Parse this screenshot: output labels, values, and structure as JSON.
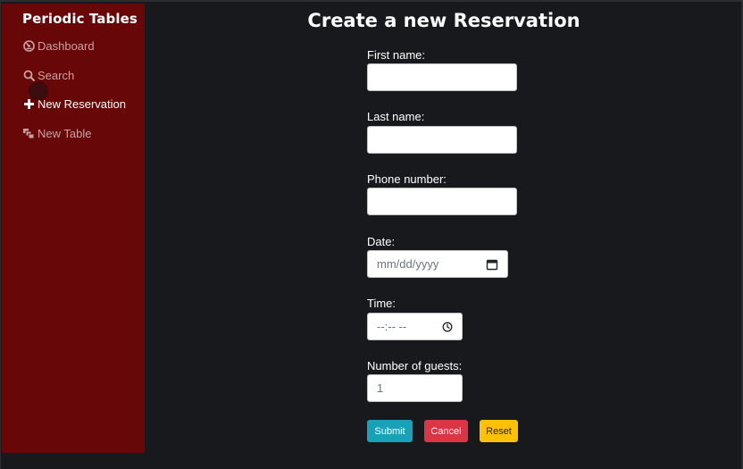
{
  "sidebar": {
    "brand": "Periodic Tables",
    "items": [
      {
        "label": "Dashboard",
        "icon": "dashboard-icon"
      },
      {
        "label": "Search",
        "icon": "search-icon"
      },
      {
        "label": "New Reservation",
        "icon": "plus-icon"
      },
      {
        "label": "New Table",
        "icon": "layers-icon"
      }
    ]
  },
  "main": {
    "title": "Create a new Reservation",
    "form": {
      "first_name": {
        "label": "First name:",
        "value": ""
      },
      "last_name": {
        "label": "Last name:",
        "value": ""
      },
      "phone": {
        "label": "Phone number:",
        "value": ""
      },
      "date": {
        "label": "Date:",
        "placeholder": "mm/dd/yyyy"
      },
      "time": {
        "label": "Time:",
        "placeholder": "--:-- --"
      },
      "guests": {
        "label": "Number of guests:",
        "value": "1"
      }
    },
    "buttons": {
      "submit": "Submit",
      "cancel": "Cancel",
      "reset": "Reset"
    }
  },
  "colors": {
    "sidebar_bg": "#680708",
    "page_bg": "#17191c",
    "submit": "#17a2b8",
    "cancel": "#dc3545",
    "reset": "#ffc107"
  }
}
